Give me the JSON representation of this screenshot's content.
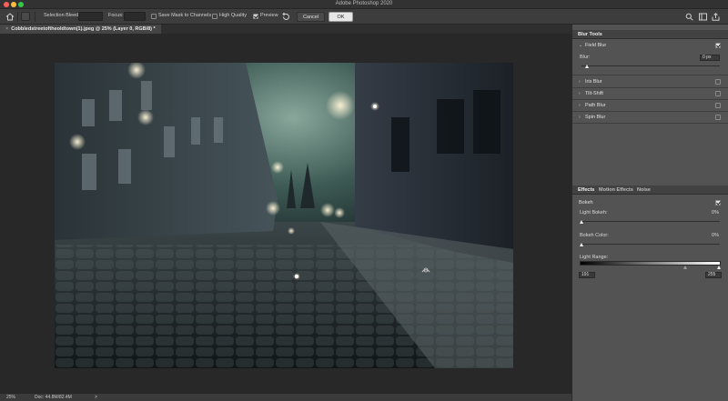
{
  "app_title": "Adobe Photoshop 2020",
  "options_bar": {
    "selection_bleed_label": "Selection Bleed:",
    "focus_label": "Focus:",
    "save_mask_label": "Save Mask to Channels",
    "save_mask_checked": false,
    "high_quality_label": "High Quality",
    "high_quality_checked": false,
    "preview_label": "Preview",
    "preview_checked": true,
    "cancel_label": "Cancel",
    "ok_label": "OK"
  },
  "document_tab": {
    "close_glyph": "×",
    "label": "Cobbledstreetoftheoldtown(1).jpeg @ 25% (Layer 0, RGB/8) *"
  },
  "status": {
    "zoom": "25%",
    "doc": "Doc: 44.8M/82.4M",
    "arrow": ">"
  },
  "blur_tools": {
    "title": "Blur Tools",
    "sections": [
      {
        "label": "Field Blur",
        "expanded": true,
        "checked": true
      },
      {
        "label": "Iris Blur",
        "expanded": false,
        "checked": false
      },
      {
        "label": "Tilt-Shift",
        "expanded": false,
        "checked": false
      },
      {
        "label": "Path Blur",
        "expanded": false,
        "checked": false
      },
      {
        "label": "Spin Blur",
        "expanded": false,
        "checked": false
      }
    ],
    "blur_label": "Blur:",
    "blur_value": "0 px"
  },
  "effects": {
    "tabs": [
      "Effects",
      "Motion Effects",
      "Noise"
    ],
    "active_tab": "Effects",
    "bokeh_label": "Bokeh",
    "bokeh_checked": true,
    "light_bokeh_label": "Light Bokeh:",
    "light_bokeh_value": "0%",
    "bokeh_color_label": "Bokeh Color:",
    "bokeh_color_value": "0%",
    "light_range_label": "Light Range:",
    "light_range_low": "191",
    "light_range_high": "255"
  },
  "colors": {
    "accent": "#e6e6e6",
    "panel_bg": "#535353",
    "canvas_bg": "#282828"
  }
}
